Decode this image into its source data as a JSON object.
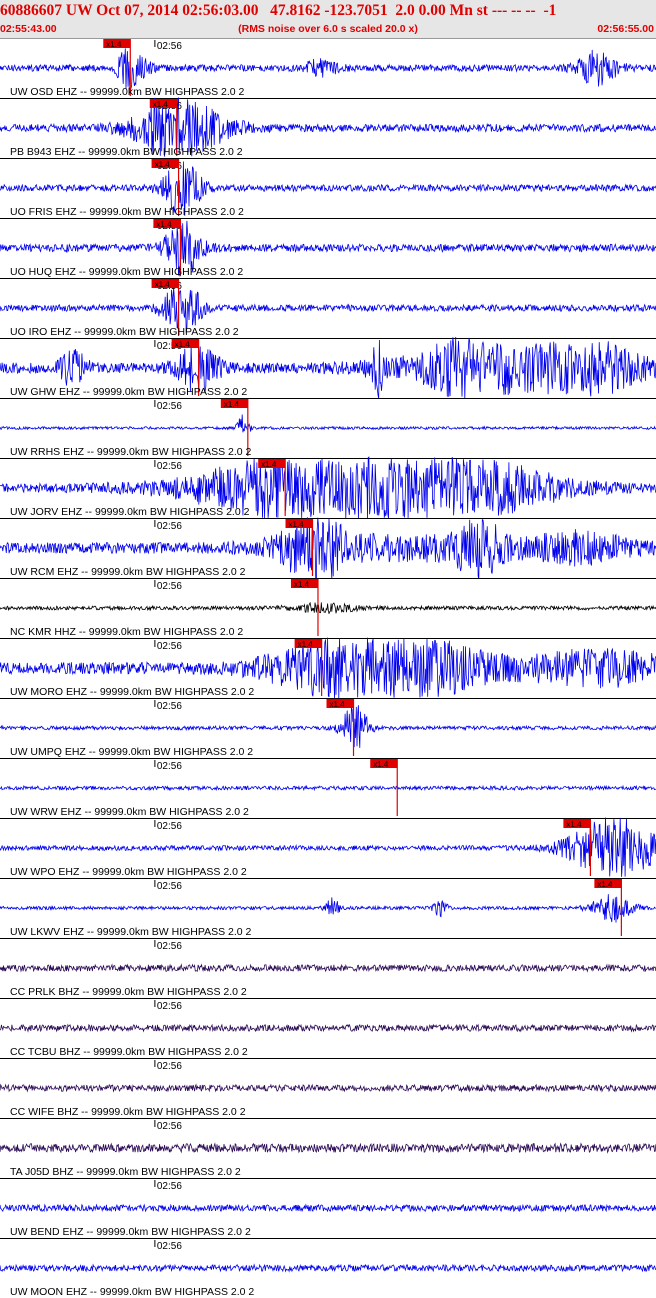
{
  "header": {
    "title": "60886607 UW Oct 07, 2014 02:56:03.00   47.8162 -123.7051  2.0 0.00 Mn st --- -- --  -1",
    "start_time": "02:55:43.00",
    "scale_note": "(RMS noise over 6.0 s scaled 20.0 x)",
    "end_time": "02:56:55.00",
    "colors": {
      "header_text": "#e00000",
      "header_bg": "#e6e6e6",
      "trace_blue": "#0000ee",
      "trace_black": "#000000",
      "trace_dark": "#2b0a55",
      "pick_marker": "#e00000"
    }
  },
  "chart_data": {
    "type": "line",
    "title": "60886607 UW Oct 07, 2014 02:56:03.00   47.8162 -123.7051  2.0 0.00 Mn st --- -- --  -1",
    "xlabel": "",
    "ylabel": "",
    "x_range": [
      "02:55:43.00",
      "02:56:55.00"
    ],
    "x_range_seconds": [
      0,
      72
    ],
    "tick_label": "02:56",
    "tick_seconds": 17,
    "grid": false,
    "pick_label": "x1.4",
    "traces": [
      {
        "label": "UW OSD EHZ -- 99999.0km BW  HIGHPASS  2.0  2",
        "color": "#0000ee",
        "pick_s": 14.3,
        "noise": 0.12,
        "bursts": [
          {
            "t": 14.6,
            "amp": 1.0,
            "dur": 1.0
          },
          {
            "t": 35.2,
            "amp": 0.3,
            "dur": 1.2
          },
          {
            "t": 65.5,
            "amp": 0.6,
            "dur": 1.5
          }
        ]
      },
      {
        "label": "PB B943 EHZ -- 99999.0km BW  HIGHPASS  2.0  2",
        "color": "#0000ee",
        "pick_s": 19.4,
        "noise": 0.14,
        "bursts": [
          {
            "t": 19.8,
            "amp": 1.0,
            "dur": 3.5
          },
          {
            "t": 17.8,
            "amp": 0.4,
            "dur": 1.0
          }
        ]
      },
      {
        "label": "UO FRIS EHZ -- 99999.0km BW  HIGHPASS  2.0  2",
        "color": "#0000ee",
        "pick_s": 19.6,
        "noise": 0.12,
        "bursts": [
          {
            "t": 20.0,
            "amp": 1.0,
            "dur": 1.4
          }
        ]
      },
      {
        "label": "UO HUQ EHZ -- 99999.0km BW  HIGHPASS  2.0  2",
        "color": "#0000ee",
        "pick_s": 19.8,
        "noise": 0.14,
        "bursts": [
          {
            "t": 20.2,
            "amp": 1.0,
            "dur": 1.4
          }
        ]
      },
      {
        "label": "UO IRO EHZ -- 99999.0km BW  HIGHPASS  2.0  2",
        "color": "#0000ee",
        "pick_s": 19.6,
        "noise": 0.12,
        "bursts": [
          {
            "t": 20.0,
            "amp": 1.0,
            "dur": 1.4
          }
        ]
      },
      {
        "label": "UW GHW EHZ -- 99999.0km BW  HIGHPASS  2.0  2",
        "color": "#0000ee",
        "pick_s": 21.8,
        "noise": 0.2,
        "bursts": [
          {
            "t": 8.0,
            "amp": 0.6,
            "dur": 1.0
          },
          {
            "t": 21.7,
            "amp": 0.8,
            "dur": 1.5
          },
          {
            "t": 41.5,
            "amp": 0.9,
            "dur": 0.6
          },
          {
            "t": 50.0,
            "amp": 0.6,
            "dur": 1.5
          },
          {
            "t": 56.0,
            "amp": 0.8,
            "dur": 8.0
          },
          {
            "t": 66.0,
            "amp": 0.5,
            "dur": 3.0
          }
        ]
      },
      {
        "label": "UW RRHS EHZ -- 99999.0km BW  HIGHPASS  2.0  2",
        "color": "#0000ee",
        "pick_s": 27.2,
        "noise": 0.05,
        "bursts": [
          {
            "t": 26.6,
            "amp": 0.45,
            "dur": 0.5
          }
        ]
      },
      {
        "label": "UW JORV EHZ -- 99999.0km BW  HIGHPASS  2.0  2",
        "color": "#0000ee",
        "pick_s": 31.3,
        "noise": 0.15,
        "bursts": [
          {
            "t": 40.0,
            "amp": 1.0,
            "dur": 12.0
          },
          {
            "t": 52.0,
            "amp": 0.5,
            "dur": 6.0
          },
          {
            "t": 27.0,
            "amp": 0.35,
            "dur": 4.0
          }
        ]
      },
      {
        "label": "UW RCM EHZ -- 99999.0km BW  HIGHPASS  2.0  2",
        "color": "#0000ee",
        "pick_s": 34.3,
        "noise": 0.2,
        "bursts": [
          {
            "t": 34.5,
            "amp": 1.0,
            "dur": 2.5
          },
          {
            "t": 52.6,
            "amp": 0.9,
            "dur": 1.5
          },
          {
            "t": 45.0,
            "amp": 0.35,
            "dur": 10.0
          },
          {
            "t": 64.0,
            "amp": 0.45,
            "dur": 4.0
          }
        ]
      },
      {
        "label": "NC KMR HHZ -- 99999.0km BW  HIGHPASS  2.0  2",
        "color": "#000000",
        "pick_s": 34.9,
        "noise": 0.07,
        "bursts": [
          {
            "t": 35.5,
            "amp": 0.15,
            "dur": 2.5
          }
        ]
      },
      {
        "label": "UW MORO EHZ -- 99999.0km BW  HIGHPASS  2.0  2",
        "color": "#0000ee",
        "pick_s": 35.3,
        "noise": 0.22,
        "bursts": [
          {
            "t": 38.5,
            "amp": 1.0,
            "dur": 6.0
          },
          {
            "t": 46.0,
            "amp": 0.7,
            "dur": 6.0
          },
          {
            "t": 66.0,
            "amp": 0.55,
            "dur": 6.0
          }
        ]
      },
      {
        "label": "UW UMPQ EHZ -- 99999.0km BW  HIGHPASS  2.0  2",
        "color": "#0000ee",
        "pick_s": 38.8,
        "noise": 0.07,
        "bursts": [
          {
            "t": 38.9,
            "amp": 0.9,
            "dur": 1.0
          }
        ]
      },
      {
        "label": "UW WRW EHZ -- 99999.0km BW  HIGHPASS  2.0  2",
        "color": "#0000ee",
        "pick_s": 43.6,
        "noise": 0.07,
        "bursts": []
      },
      {
        "label": "UW WPO EHZ -- 99999.0km BW  HIGHPASS  2.0  2",
        "color": "#0000ee",
        "pick_s": 64.8,
        "noise": 0.09,
        "bursts": [
          {
            "t": 66.5,
            "amp": 0.8,
            "dur": 3.0
          },
          {
            "t": 69.5,
            "amp": 0.45,
            "dur": 3.5
          }
        ]
      },
      {
        "label": "UW LKWV EHZ -- 99999.0km BW  HIGHPASS  2.0  2",
        "color": "#0000ee",
        "pick_s": 68.2,
        "noise": 0.06,
        "bursts": [
          {
            "t": 36.5,
            "amp": 0.35,
            "dur": 0.5
          },
          {
            "t": 48.3,
            "amp": 0.3,
            "dur": 0.5
          },
          {
            "t": 67.2,
            "amp": 0.5,
            "dur": 1.5
          }
        ]
      },
      {
        "label": "CC PRLK BHZ -- 99999.0km BW  HIGHPASS  2.0  2",
        "color": "#2b0a55",
        "pick_s": null,
        "noise": 0.12,
        "bursts": []
      },
      {
        "label": "CC TCBU BHZ -- 99999.0km BW  HIGHPASS  2.0  2",
        "color": "#2b0a55",
        "pick_s": null,
        "noise": 0.12,
        "bursts": []
      },
      {
        "label": "CC WIFE BHZ -- 99999.0km BW  HIGHPASS  2.0  2",
        "color": "#2b0a55",
        "pick_s": null,
        "noise": 0.12,
        "bursts": []
      },
      {
        "label": "TA J05D BHZ -- 99999.0km BW  HIGHPASS  2.0  2",
        "color": "#2b0a55",
        "pick_s": null,
        "noise": 0.16,
        "bursts": []
      },
      {
        "label": "UW BEND EHZ -- 99999.0km BW  HIGHPASS  2.0  2",
        "color": "#0000ee",
        "pick_s": null,
        "noise": 0.12,
        "bursts": []
      },
      {
        "label": "UW MOON EHZ -- 99999.0km BW  HIGHPASS  2.0  2",
        "color": "#0000ee",
        "pick_s": null,
        "noise": 0.12,
        "bursts": []
      }
    ]
  }
}
